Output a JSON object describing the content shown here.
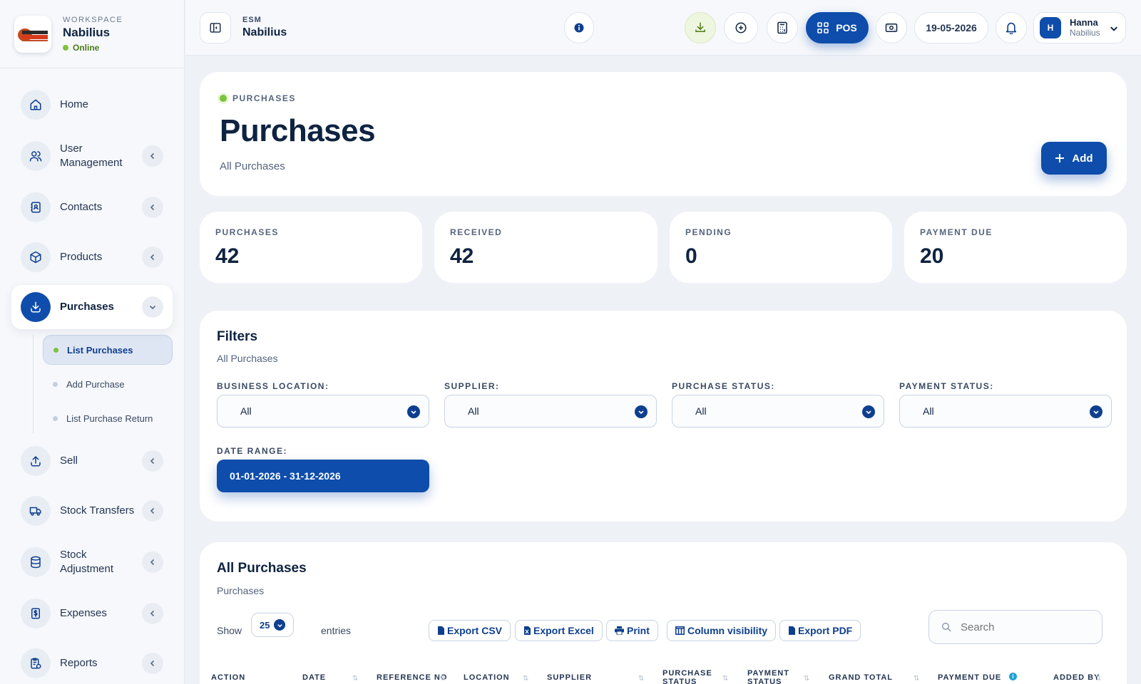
{
  "workspace": {
    "label": "WORKSPACE",
    "name": "Nabilius",
    "status": "Online"
  },
  "sidebar": {
    "items": [
      {
        "label": "Home",
        "icon": "home-icon"
      },
      {
        "label": "User Management",
        "icon": "users-icon"
      },
      {
        "label": "Contacts",
        "icon": "contacts-icon"
      },
      {
        "label": "Products",
        "icon": "box-icon"
      },
      {
        "label": "Purchases",
        "icon": "download-icon"
      },
      {
        "label": "Sell",
        "icon": "upload-icon"
      },
      {
        "label": "Stock Transfers",
        "icon": "truck-icon"
      },
      {
        "label": "Stock Adjustment",
        "icon": "database-icon"
      },
      {
        "label": "Expenses",
        "icon": "dollar-doc-icon"
      },
      {
        "label": "Reports",
        "icon": "report-icon"
      }
    ],
    "purchases_sub": [
      {
        "label": "List Purchases"
      },
      {
        "label": "Add Purchase"
      },
      {
        "label": "List Purchase Return"
      }
    ]
  },
  "header": {
    "eyebrow": "ESM",
    "title": "Nabilius",
    "pos_label": "POS",
    "date": "19-05-2026",
    "user": {
      "initial": "H",
      "name": "Hanna",
      "org": "Nabilius"
    }
  },
  "page": {
    "eyebrow": "PURCHASES",
    "title": "Purchases",
    "subtitle": "All Purchases",
    "add_label": "Add"
  },
  "stats": [
    {
      "label": "PURCHASES",
      "value": "42"
    },
    {
      "label": "RECEIVED",
      "value": "42"
    },
    {
      "label": "PENDING",
      "value": "0"
    },
    {
      "label": "PAYMENT DUE",
      "value": "20"
    }
  ],
  "filters": {
    "title": "Filters",
    "subtitle": "All Purchases",
    "fields": [
      {
        "label": "BUSINESS LOCATION:",
        "value": "All"
      },
      {
        "label": "SUPPLIER:",
        "value": "All"
      },
      {
        "label": "PURCHASE STATUS:",
        "value": "All"
      },
      {
        "label": "PAYMENT STATUS:",
        "value": "All"
      }
    ],
    "date_label": "DATE RANGE:",
    "date_value": "01-01-2026 - 31-12-2026"
  },
  "table": {
    "title": "All Purchases",
    "subtitle": "Purchases",
    "show_label": "Show",
    "entries_value": "25",
    "entries_label": "entries",
    "buttons": [
      "Export CSV",
      "Export Excel",
      "Print",
      "Column visibility",
      "Export PDF"
    ],
    "search_placeholder": "Search",
    "columns": [
      "ACTION",
      "DATE",
      "REFERENCE NO",
      "LOCATION",
      "SUPPLIER",
      "PURCHASE STATUS",
      "PAYMENT STATUS",
      "GRAND TOTAL",
      "PAYMENT DUE",
      "ADDED BY"
    ]
  },
  "colors": {
    "primary": "#0e4dab",
    "online": "#7cc43a",
    "text": "#0f2341"
  }
}
